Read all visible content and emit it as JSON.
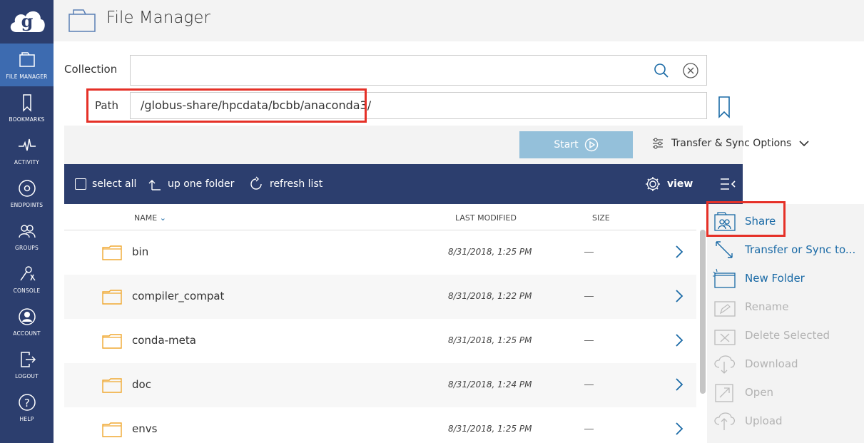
{
  "header": {
    "title": "File Manager"
  },
  "sidebar": {
    "items": [
      {
        "label": "FILE MANAGER",
        "icon": "folder-icon"
      },
      {
        "label": "BOOKMARKS",
        "icon": "bookmark-icon"
      },
      {
        "label": "ACTIVITY",
        "icon": "activity-icon"
      },
      {
        "label": "ENDPOINTS",
        "icon": "endpoint-icon"
      },
      {
        "label": "GROUPS",
        "icon": "groups-icon"
      },
      {
        "label": "CONSOLE",
        "icon": "console-icon"
      },
      {
        "label": "ACCOUNT",
        "icon": "account-icon"
      },
      {
        "label": "LOGOUT",
        "icon": "logout-icon"
      },
      {
        "label": "HELP",
        "icon": "help-icon"
      }
    ]
  },
  "collection": {
    "label": "Collection",
    "value": ""
  },
  "path": {
    "label": "Path",
    "value": "/globus-share/hpcdata/bcbb/anaconda3/"
  },
  "transfer": {
    "start_label": "Start",
    "options_label": "Transfer & Sync Options"
  },
  "toolbar": {
    "select_all": "select all",
    "up_folder": "up one folder",
    "refresh": "refresh list",
    "view": "view"
  },
  "columns": {
    "name": "NAME",
    "modified": "LAST MODIFIED",
    "size": "SIZE"
  },
  "files": [
    {
      "name": "bin",
      "modified": "8/31/2018, 1:25 PM",
      "size": "—"
    },
    {
      "name": "compiler_compat",
      "modified": "8/31/2018, 1:22 PM",
      "size": "—"
    },
    {
      "name": "conda-meta",
      "modified": "8/31/2018, 1:25 PM",
      "size": "—"
    },
    {
      "name": "doc",
      "modified": "8/31/2018, 1:24 PM",
      "size": "—"
    },
    {
      "name": "envs",
      "modified": "8/31/2018, 1:25 PM",
      "size": "—"
    }
  ],
  "panel": {
    "items": [
      {
        "label": "Share",
        "enabled": true
      },
      {
        "label": "Transfer or Sync to...",
        "enabled": true
      },
      {
        "label": "New Folder",
        "enabled": true
      },
      {
        "label": "Rename",
        "enabled": false
      },
      {
        "label": "Delete Selected",
        "enabled": false
      },
      {
        "label": "Download",
        "enabled": false
      },
      {
        "label": "Open",
        "enabled": false
      },
      {
        "label": "Upload",
        "enabled": false
      }
    ]
  },
  "colors": {
    "sidebar": "#2c3e6e",
    "active": "#3d6bb0",
    "accent": "#1a6aa6",
    "folder": "#f0a830",
    "highlight": "#e53027"
  }
}
